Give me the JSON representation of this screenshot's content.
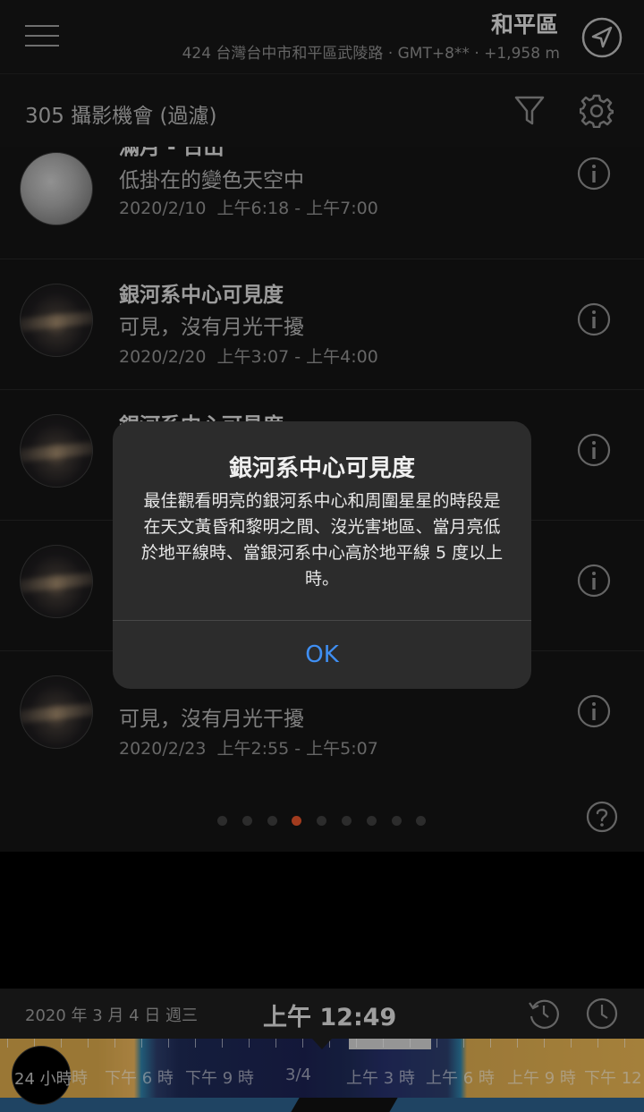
{
  "header": {
    "location_name": "和平區",
    "location_detail": "424 台灣台中市和平區武陵路 · GMT+8** · +1,958 m",
    "menu_icon": "hamburger-menu-icon",
    "nav_icon": "location-arrow-icon"
  },
  "toolbar": {
    "count_label": "305  攝影機會 (過濾)",
    "filter_icon": "filter-icon",
    "settings_icon": "gear-icon"
  },
  "events": [
    {
      "thumb": "full-moon",
      "title": "滿月 - 日出",
      "subtitle": "低掛在的變色天空中",
      "date": "2020/2/10",
      "time": "上午6:18 - 上午7:00"
    },
    {
      "thumb": "milky-way",
      "title": "銀河系中心可見度",
      "subtitle": "可見，沒有月光干擾",
      "date": "2020/2/20",
      "time": "上午3:07 - 上午4:00"
    },
    {
      "thumb": "milky-way",
      "title": "銀河系中心可見度",
      "subtitle": "",
      "date": "",
      "time": ""
    },
    {
      "thumb": "milky-way",
      "title": "",
      "subtitle": "",
      "date": "",
      "time": ""
    },
    {
      "thumb": "milky-way",
      "title": "",
      "subtitle": "可見，沒有月光干擾",
      "date": "2020/2/23",
      "time": "上午2:55 - 上午5:07"
    }
  ],
  "pager": {
    "pages": 9,
    "active_page": 4,
    "active_color": "#e0522a"
  },
  "timebar": {
    "date": "2020 年 3 月 4 日  週三",
    "time": "上午 12:49"
  },
  "timeline": {
    "range_label": "24 小時",
    "labels": [
      "時",
      "下午 6 時",
      "下午 9 時",
      "3/4",
      "上午 3 時",
      "上午 6 時",
      "上午 9 時",
      "下午 12"
    ]
  },
  "alert": {
    "title": "銀河系中心可見度",
    "message": "最佳觀看明亮的銀河系中心和周圍星星的時段是在天文黃昏和黎明之間、沒光害地區、當月亮低於地平線時、當銀河系中心高於地平線 5 度以上時。",
    "ok_label": "OK",
    "ok_color": "#3f8ff3"
  }
}
